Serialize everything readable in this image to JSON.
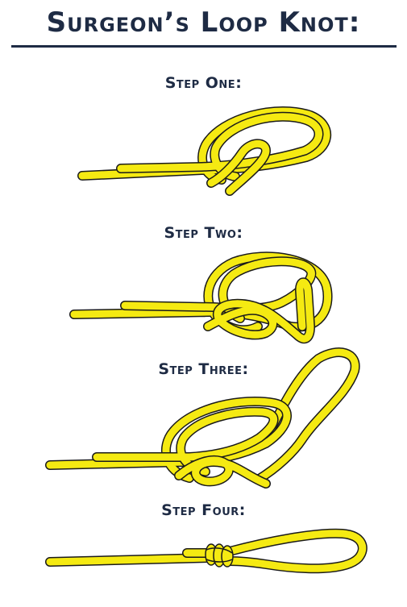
{
  "title": "Surgeon’s Loop Knot:",
  "steps": [
    {
      "label": "Step One:"
    },
    {
      "label": "Step Two:"
    },
    {
      "label": "Step Three:"
    },
    {
      "label": "Step Four:"
    }
  ],
  "colors": {
    "rope": "#f5ea12",
    "outline": "#1a1a1a",
    "heading": "#1e2b44"
  }
}
